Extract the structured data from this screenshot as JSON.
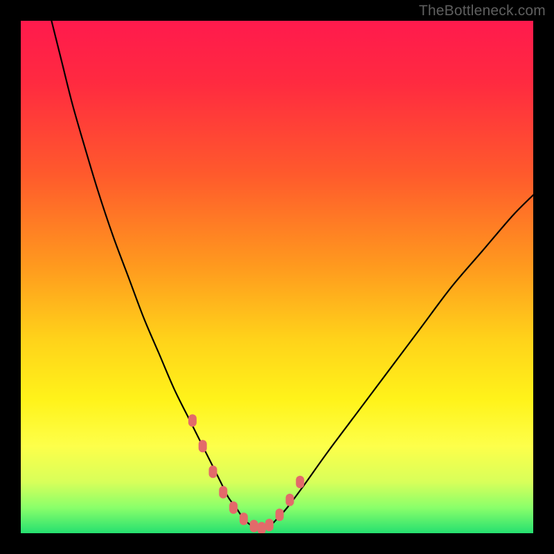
{
  "watermark": "TheBottleneck.com",
  "colors": {
    "gradient_stops": [
      {
        "offset": 0.0,
        "color": "#ff1a4d"
      },
      {
        "offset": 0.12,
        "color": "#ff2a40"
      },
      {
        "offset": 0.3,
        "color": "#ff5a2c"
      },
      {
        "offset": 0.48,
        "color": "#ff9a1e"
      },
      {
        "offset": 0.62,
        "color": "#ffd21a"
      },
      {
        "offset": 0.74,
        "color": "#fff31a"
      },
      {
        "offset": 0.83,
        "color": "#fdff4a"
      },
      {
        "offset": 0.9,
        "color": "#d8ff5a"
      },
      {
        "offset": 0.95,
        "color": "#8aff6a"
      },
      {
        "offset": 1.0,
        "color": "#25e070"
      }
    ],
    "curve": "#000000",
    "markers": "#e36a6a"
  },
  "chart_data": {
    "type": "line",
    "title": "",
    "xlabel": "",
    "ylabel": "",
    "xlim": [
      0,
      100
    ],
    "ylim": [
      0,
      100
    ],
    "grid": false,
    "legend": false,
    "series": [
      {
        "name": "bottleneck-curve",
        "x": [
          6,
          8,
          10,
          12,
          15,
          18,
          21,
          24,
          27,
          30,
          33,
          35,
          37,
          39,
          40.5,
          42,
          43,
          44,
          45,
          46,
          47,
          48,
          49,
          50,
          52,
          55,
          60,
          66,
          72,
          78,
          84,
          90,
          96,
          100
        ],
        "y": [
          100,
          92,
          84,
          77,
          67,
          58,
          50,
          42,
          35,
          28,
          22,
          18,
          14,
          10,
          7,
          5,
          3.5,
          2.3,
          1.5,
          1,
          1,
          1.2,
          1.8,
          2.8,
          5,
          9,
          16,
          24,
          32,
          40,
          48,
          55,
          62,
          66
        ]
      }
    ],
    "markers": {
      "name": "highlight-points",
      "x": [
        33.5,
        35.5,
        37.5,
        39.5,
        41.5,
        43.5,
        45.5,
        47.0,
        48.5,
        50.5,
        52.5,
        54.5
      ],
      "y": [
        22,
        17,
        12,
        8,
        5,
        2.8,
        1.4,
        1.0,
        1.6,
        3.6,
        6.5,
        10
      ]
    }
  }
}
